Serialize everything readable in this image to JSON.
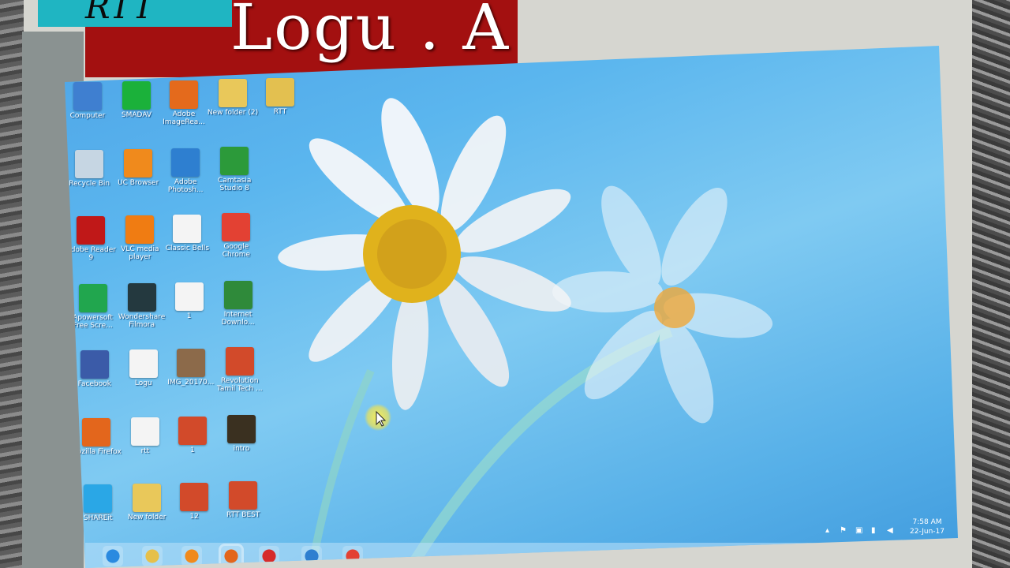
{
  "banner": {
    "tab_text": "RTT",
    "title": "Logu . A"
  },
  "desktop": {
    "icons": [
      {
        "label": "Computer",
        "icon": "computer-icon",
        "color": "#3f7fd0"
      },
      {
        "label": "SMADAV",
        "icon": "smadav-icon",
        "color": "#1bb13a"
      },
      {
        "label": "Adobe ImageRea...",
        "icon": "adobe-imageready-icon",
        "color": "#e46a1c"
      },
      {
        "label": "New folder (2)",
        "icon": "folder-icon",
        "color": "#e9c85a"
      },
      {
        "label": "RTT",
        "icon": "folder-icon",
        "color": "#e3c050"
      },
      {
        "label": "Recycle Bin",
        "icon": "recycle-bin-icon",
        "color": "#c6d6e3"
      },
      {
        "label": "UC Browser",
        "icon": "uc-browser-icon",
        "color": "#f08a1c"
      },
      {
        "label": "Adobe Photosh...",
        "icon": "adobe-photoshop-icon",
        "color": "#2e7fd0"
      },
      {
        "label": "Camtasia Studio 8",
        "icon": "camtasia-icon",
        "color": "#2c9a3a"
      },
      {
        "label": "Adobe Reader 9",
        "icon": "adobe-reader-icon",
        "color": "#c01818"
      },
      {
        "label": "VLC media player",
        "icon": "vlc-icon",
        "color": "#f07c12"
      },
      {
        "label": "Classic Bells",
        "icon": "docx-icon",
        "color": "#f4f4f4"
      },
      {
        "label": "Google Chrome",
        "icon": "chrome-icon",
        "color": "#e34133"
      },
      {
        "label": "Apowersoft Free Scre...",
        "icon": "apowersoft-icon",
        "color": "#21a64e"
      },
      {
        "label": "Wondershare Filmora",
        "icon": "filmora-icon",
        "color": "#24393f"
      },
      {
        "label": "1",
        "icon": "docx-icon",
        "color": "#f4f4f4"
      },
      {
        "label": "Internet Downlo...",
        "icon": "idm-icon",
        "color": "#2f8a3a"
      },
      {
        "label": "Facebook",
        "icon": "facebook-icon",
        "color": "#3b5ba8"
      },
      {
        "label": "Logu",
        "icon": "docx-icon",
        "color": "#f4f4f4"
      },
      {
        "label": "IMG_20170...",
        "icon": "photo-icon",
        "color": "#8c6a4a"
      },
      {
        "label": "Revolution Tamil Tech ...",
        "icon": "rtt-image-icon",
        "color": "#d24a2a"
      },
      {
        "label": "Mozilla Firefox",
        "icon": "firefox-icon",
        "color": "#e3661c"
      },
      {
        "label": "rtt",
        "icon": "file-icon",
        "color": "#f4f4f4"
      },
      {
        "label": "1",
        "icon": "rtt-image-icon",
        "color": "#d24a2a"
      },
      {
        "label": "intro",
        "icon": "video-icon",
        "color": "#3a3020"
      },
      {
        "label": "SHAREit",
        "icon": "shareit-icon",
        "color": "#2aa7e6"
      },
      {
        "label": "New folder",
        "icon": "folder-icon",
        "color": "#e9c85a"
      },
      {
        "label": "12",
        "icon": "rtt-image-icon",
        "color": "#d24a2a"
      },
      {
        "label": "RTT BEST",
        "icon": "rtt-image-icon",
        "color": "#d24a2a"
      }
    ]
  },
  "taskbar": {
    "buttons": [
      {
        "name": "internet-explorer-icon",
        "color": "#2a8ae0"
      },
      {
        "name": "file-explorer-icon",
        "color": "#e6c04a"
      },
      {
        "name": "uc-browser-icon",
        "color": "#f08a1c"
      },
      {
        "name": "firefox-icon",
        "color": "#e3661c"
      },
      {
        "name": "apowersoft-icon",
        "color": "#d62b2b"
      },
      {
        "name": "photoshop-icon",
        "color": "#2e7fd0"
      },
      {
        "name": "chrome-icon",
        "color": "#e34133"
      }
    ],
    "time": "7:58 AM",
    "date": "22-Jun-17"
  }
}
